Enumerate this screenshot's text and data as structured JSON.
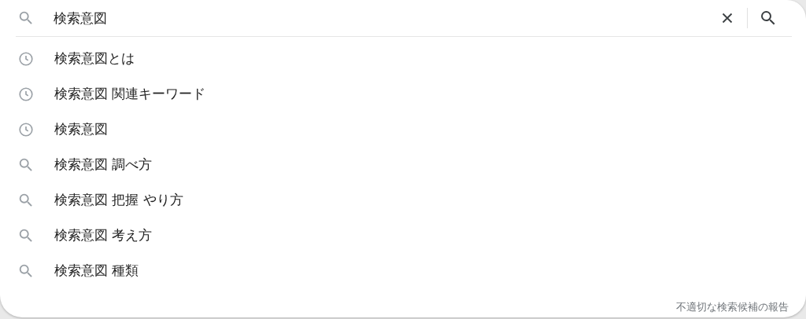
{
  "search": {
    "value": "検索意図"
  },
  "suggestions": [
    {
      "kind": "history",
      "text": "検索意図とは"
    },
    {
      "kind": "history",
      "text": "検索意図 関連キーワード"
    },
    {
      "kind": "history",
      "text": "検索意図"
    },
    {
      "kind": "search",
      "text": "検索意図 調べ方"
    },
    {
      "kind": "search",
      "text": "検索意図 把握 やり方"
    },
    {
      "kind": "search",
      "text": "検索意図 考え方"
    },
    {
      "kind": "search",
      "text": "検索意図 種類"
    }
  ],
  "report_link": "不適切な検索候補の報告"
}
